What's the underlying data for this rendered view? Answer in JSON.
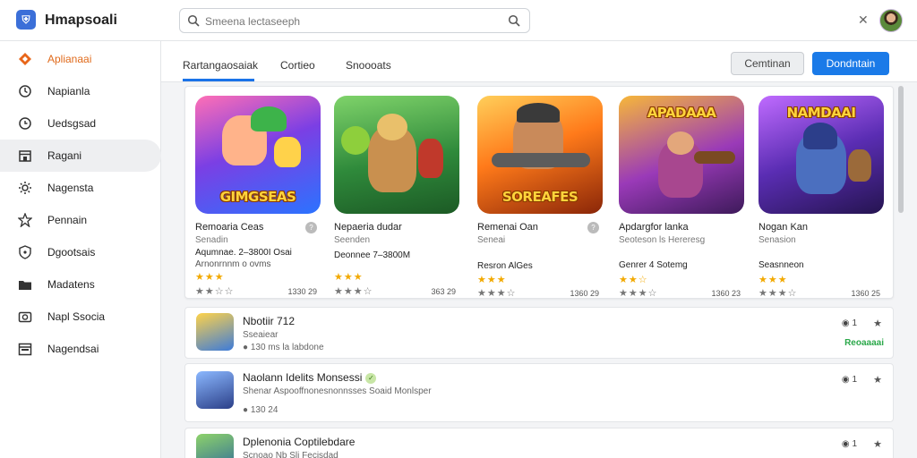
{
  "app": {
    "name": "Hmapsoali",
    "logo_icon": "shield-icon"
  },
  "search": {
    "placeholder": "Smeena lectaseeph",
    "icon": "search-icon"
  },
  "header": {
    "close_icon": "close-icon",
    "avatar": "user-avatar"
  },
  "sidebar": {
    "items": [
      {
        "label": "Aplianaai",
        "icon": "diamond-icon",
        "active": false,
        "accent": true
      },
      {
        "label": "Napianla",
        "icon": "clock-icon",
        "active": false
      },
      {
        "label": "Uedsgsad",
        "icon": "history-icon",
        "active": false
      },
      {
        "label": "Ragani",
        "icon": "store-icon",
        "active": true
      },
      {
        "label": "Nagensta",
        "icon": "gear-icon",
        "active": false
      },
      {
        "label": "Pennain",
        "icon": "puzzle-icon",
        "active": false
      },
      {
        "label": "Dgootsais",
        "icon": "shield-icon",
        "active": false
      },
      {
        "label": "Madatens",
        "icon": "folder-icon",
        "active": false
      },
      {
        "label": "Napl Ssocia",
        "icon": "camera-icon",
        "active": false
      },
      {
        "label": "Nagendsai",
        "icon": "calendar-icon",
        "active": false
      }
    ]
  },
  "tabs": [
    {
      "label": "Rartangaosaiak",
      "active": true
    },
    {
      "label": "Cortieo",
      "active": false
    },
    {
      "label": "Snoooats",
      "active": false
    }
  ],
  "actions": {
    "secondary_label": "Cemtinan",
    "primary_label": "Dondntain"
  },
  "colors": {
    "accent": "#1a7ae8",
    "sidebar_accent": "#e06a1b",
    "status_green": "#2ba84a",
    "star": "#f2a900"
  },
  "featured": [
    {
      "art_title": "GIMGSEAS",
      "name": "Remoaria Ceas",
      "sub": "Senadin",
      "meta": "Aqumnae. 2–3800I Osai",
      "meta2": "Arnonrnnm o ovms",
      "rating": 3,
      "count": "1330 29"
    },
    {
      "art_title": "",
      "name": "Nepaeria dudar",
      "sub": "Seenden",
      "meta": "Deonnee 7–3800M",
      "rating": 3,
      "count": "363 29"
    },
    {
      "art_title": "SOREAFES",
      "name": "Remenai Oan",
      "sub": "Seneai",
      "meta": "Resron AlGes",
      "rating": 3,
      "count": "1360 29"
    },
    {
      "art_title": "APADAAA",
      "name": "Apdargfor lanka",
      "sub": "Seoteson ls Hereresg",
      "meta": "Genrer 4 Sotemg",
      "rating": 3,
      "count": "1360 23"
    },
    {
      "art_title": "NAMDAAI",
      "name": "Nogan Kan",
      "sub": "Senasion",
      "meta": "Seasnneon",
      "rating": 3,
      "count": "1360 25"
    }
  ],
  "list": [
    {
      "title": "Nbotiir 712",
      "desc": "Sseaiear",
      "line3": "130 ms la labdone",
      "tag": "1",
      "status": "Reoaaaai"
    },
    {
      "title": "Naolann Idelits Monsessi",
      "desc": "Shenar Aspooffnonesnonnsses Soaid Monlsper",
      "line3": "130 24",
      "tag": "1",
      "status": ""
    },
    {
      "title": "Dplenonia Coptilebdare",
      "desc": "Scnoao Nb Sli Fecisdad",
      "line3": "",
      "tag": "1",
      "status": ""
    }
  ]
}
